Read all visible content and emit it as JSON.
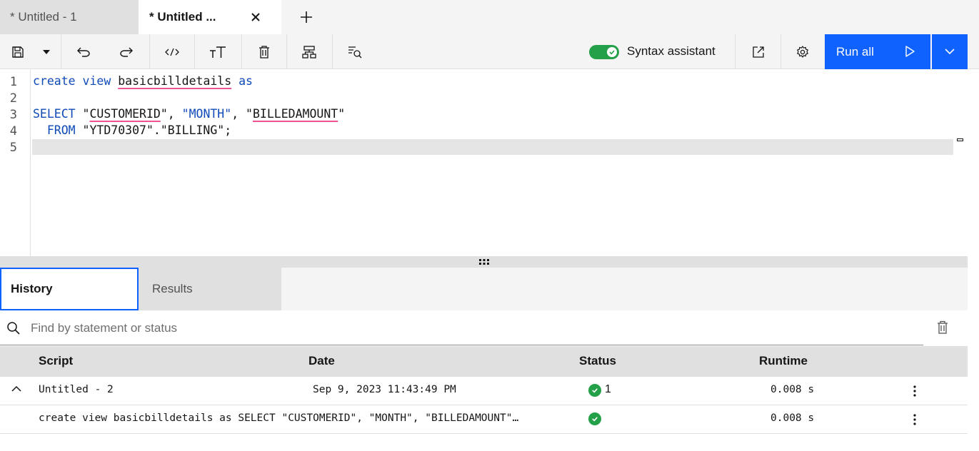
{
  "tabs": [
    {
      "label": "* Untitled - 1",
      "active": false
    },
    {
      "label": "* Untitled ...",
      "active": true
    }
  ],
  "toolbar": {
    "syntax_assistant_label": "Syntax assistant",
    "syntax_assistant_on": true,
    "run_label": "Run all"
  },
  "editor": {
    "line_numbers": [
      "1",
      "2",
      "3",
      "4",
      "5"
    ],
    "active_line": 5
  },
  "bottom_tabs": {
    "history": "History",
    "results": "Results",
    "active": "History"
  },
  "search": {
    "placeholder": "Find by statement or status",
    "value": ""
  },
  "table": {
    "headers": {
      "script": "Script",
      "date": "Date",
      "status": "Status",
      "runtime": "Runtime"
    },
    "group_row": {
      "script": "Untitled - 2",
      "date": "Sep 9, 2023 11:43:49 PM",
      "status_count": "1",
      "runtime": "0.008 s",
      "expanded": true
    },
    "child_row": {
      "statement": "create view basicbilldetails as SELECT \"CUSTOMERID\", \"MONTH\", \"BILLEDAMOUNT\"…",
      "runtime": "0.008 s"
    }
  },
  "colors": {
    "primary": "#0f62fe",
    "success": "#24a148",
    "squiggle": "#ee5396",
    "keyword": "#0f4ab8"
  }
}
